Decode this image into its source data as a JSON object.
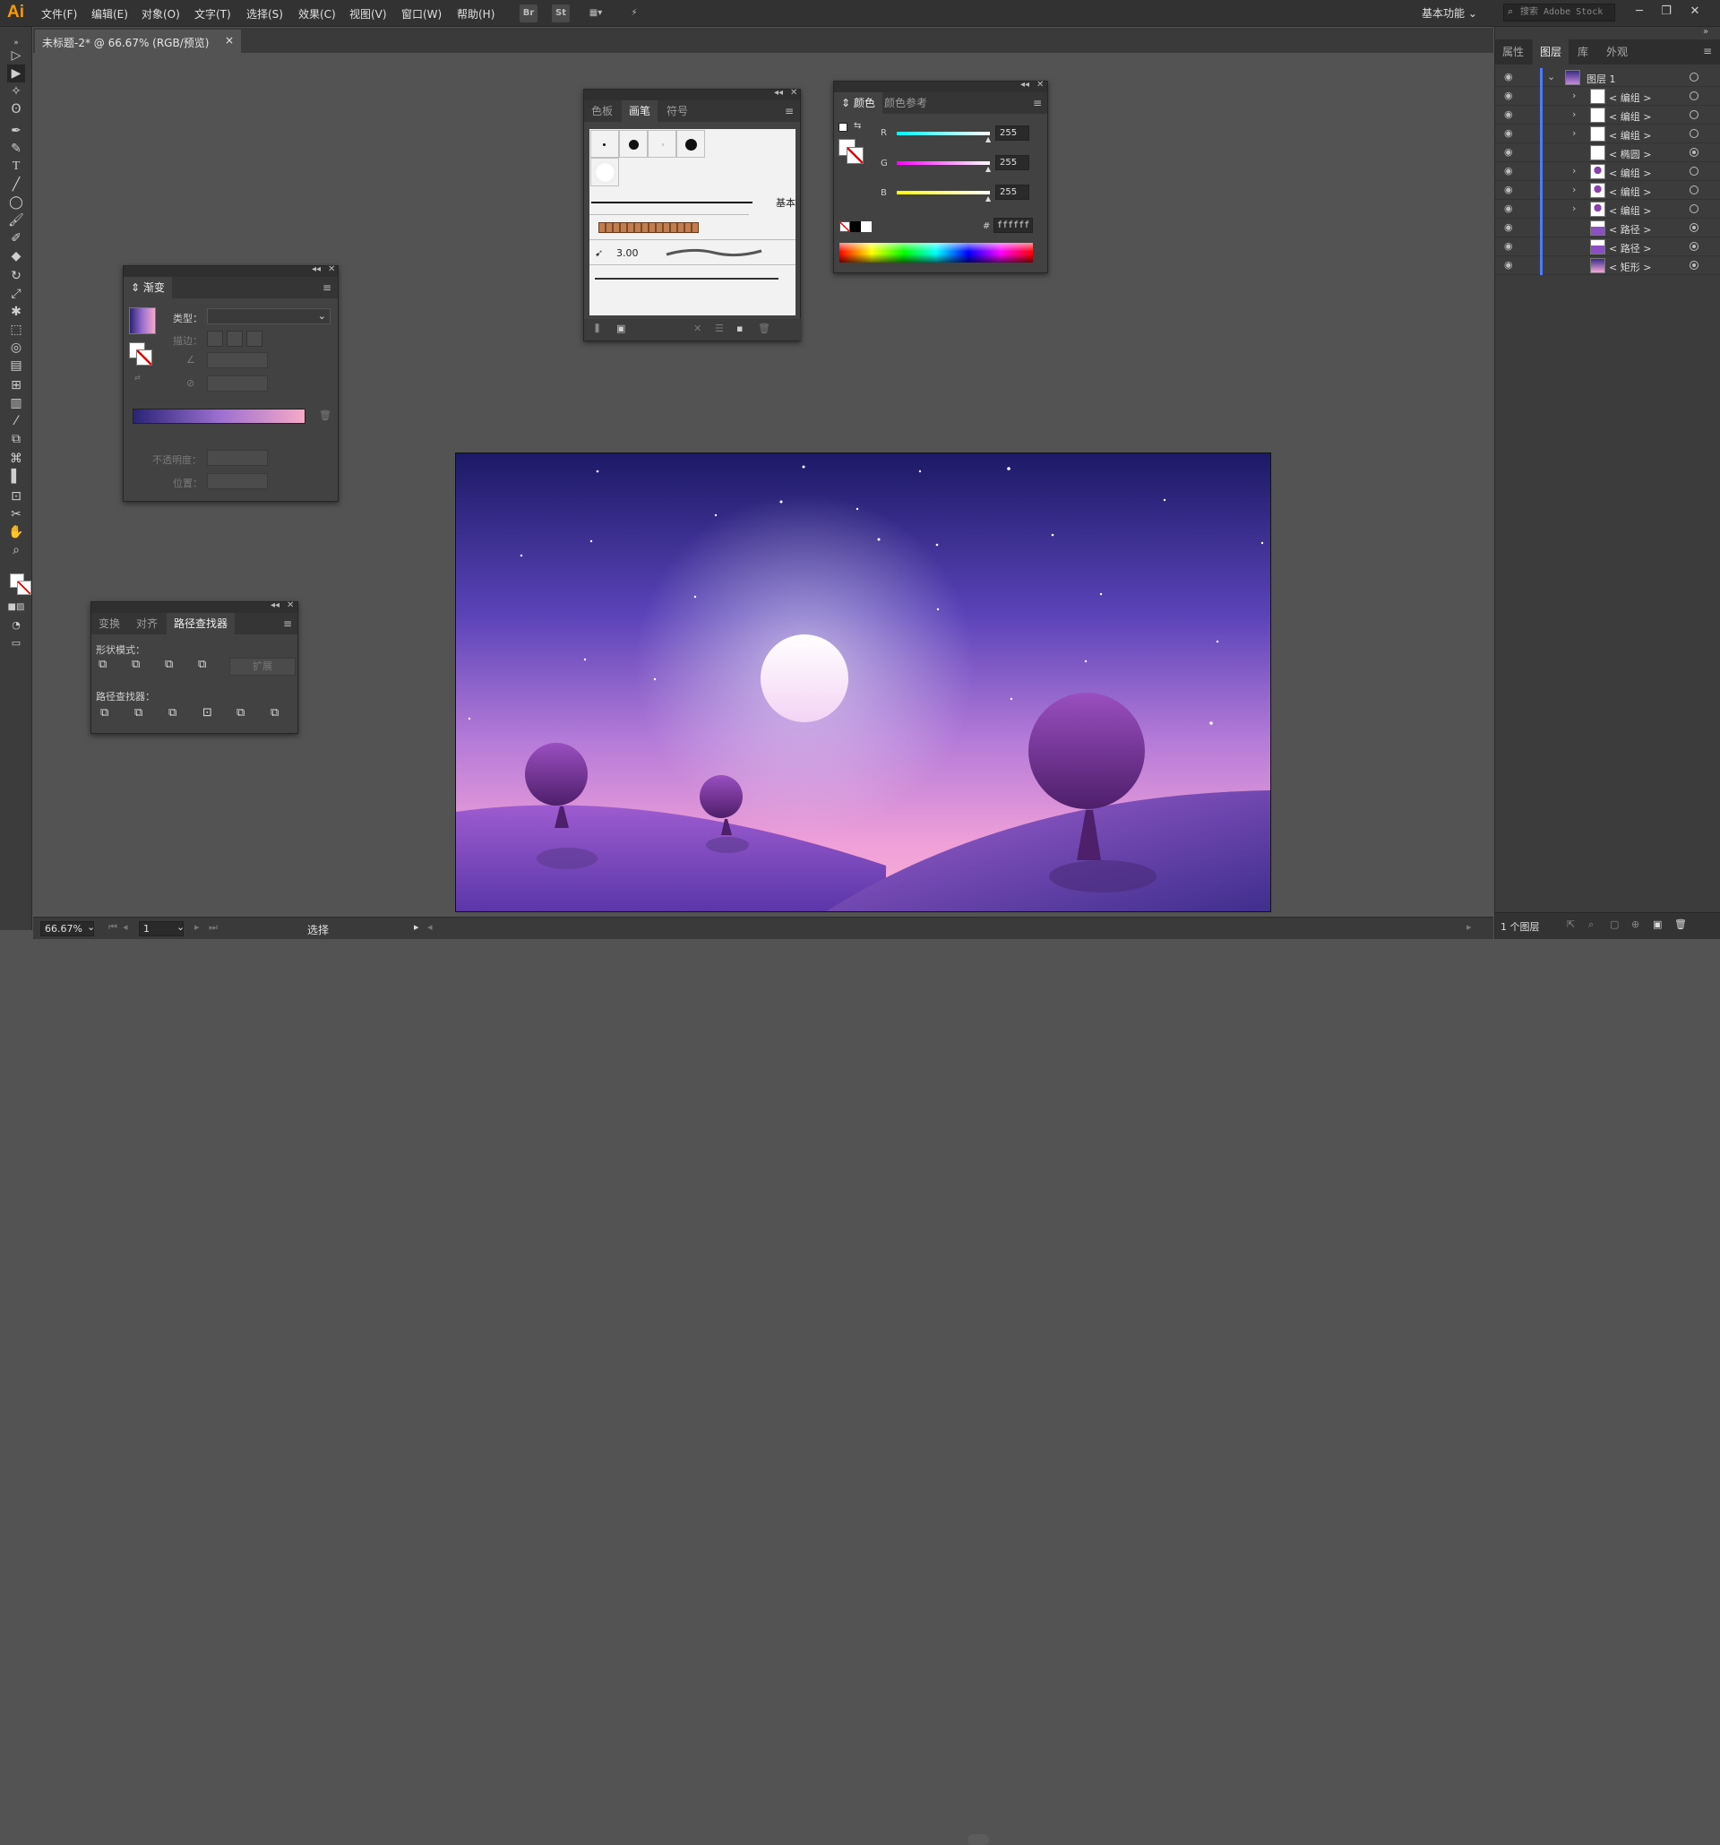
{
  "app": {
    "logo": "Ai",
    "accent": "#ff9a00"
  },
  "menu": [
    "文件(F)",
    "编辑(E)",
    "对象(O)",
    "文字(T)",
    "选择(S)",
    "效果(C)",
    "视图(V)",
    "窗口(W)",
    "帮助(H)"
  ],
  "toolbar_buttons": {
    "bridge": "Br",
    "stock": "St"
  },
  "workspace": "基本功能",
  "search": {
    "placeholder": "搜索 Adobe Stock"
  },
  "document": {
    "tab_title": "未标题-2* @ 66.67% (RGB/预览)",
    "close": "×"
  },
  "gradient_panel": {
    "title": "渐变",
    "type_label": "类型：",
    "stroke_label": "描边：",
    "opacity_label": "不透明度：",
    "location_label": "位置：",
    "gradient_start": "#2a2475",
    "gradient_mid": "#9b6fd0",
    "gradient_end": "#f7a9c8"
  },
  "brushes_panel": {
    "tabs": [
      "色板",
      "画笔",
      "符号"
    ],
    "active_tab": 1,
    "basic_label": "基本",
    "size_value": "3.00"
  },
  "color_panel": {
    "tabs": [
      "颜色",
      "颜色参考"
    ],
    "active_tab": 0,
    "channels": [
      {
        "label": "R",
        "value": "255",
        "color": "#00ffff"
      },
      {
        "label": "G",
        "value": "255",
        "color": "#ff00ff"
      },
      {
        "label": "B",
        "value": "255",
        "color": "#ffff00"
      }
    ],
    "hex_label": "#",
    "hex_value": "ffffff"
  },
  "pathfinder_panel": {
    "tabs": [
      "变换",
      "对齐",
      "路径查找器"
    ],
    "active_tab": 2,
    "shape_modes_label": "形状模式：",
    "pathfinders_label": "路径查找器：",
    "expand_label": "扩展"
  },
  "layers_panel": {
    "tabs": [
      "属性",
      "图层",
      "库",
      "外观"
    ],
    "active_tab": 1,
    "layer_name": "图层 1",
    "items": [
      {
        "name": "< 编组 >",
        "arrow": true,
        "thumb": "white",
        "target": "empty"
      },
      {
        "name": "< 编组 >",
        "arrow": true,
        "thumb": "white",
        "target": "empty"
      },
      {
        "name": "< 编组 >",
        "arrow": true,
        "thumb": "white",
        "target": "empty"
      },
      {
        "name": "< 椭圆 >",
        "arrow": false,
        "thumb": "white",
        "target": "filled"
      },
      {
        "name": "< 编组 >",
        "arrow": true,
        "thumb": "tree",
        "target": "empty"
      },
      {
        "name": "< 编组 >",
        "arrow": true,
        "thumb": "tree",
        "target": "empty"
      },
      {
        "name": "< 编组 >",
        "arrow": true,
        "thumb": "tree",
        "target": "empty"
      },
      {
        "name": "< 路径 >",
        "arrow": false,
        "thumb": "hill",
        "target": "filled"
      },
      {
        "name": "< 路径 >",
        "arrow": false,
        "thumb": "hill",
        "target": "filled"
      },
      {
        "name": "< 矩形 >",
        "arrow": false,
        "thumb": "sky",
        "target": "filled"
      }
    ],
    "footer_count": "1 个图层"
  },
  "statusbar": {
    "zoom": "66.67%",
    "artboard": "1",
    "tool": "选择"
  },
  "artwork": {
    "sky_top": "#1e1e6a",
    "sky_mid": "#7a5ad0",
    "sky_bottom": "#f5a8d8",
    "hill": "#8a4fc0",
    "tree": "#6a2c8a"
  }
}
